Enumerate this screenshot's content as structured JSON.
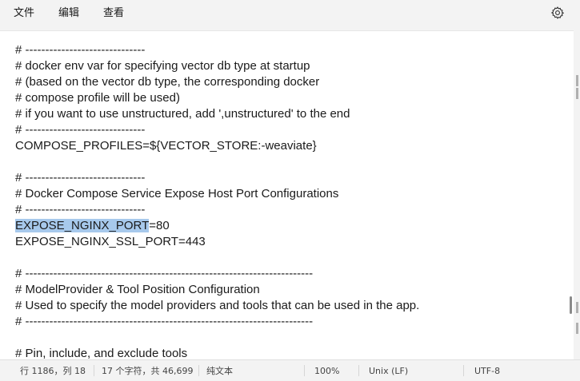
{
  "menu": {
    "file": "文件",
    "edit": "编辑",
    "view": "查看"
  },
  "settings_icon": "gear-icon",
  "editor": {
    "lines": [
      "# ------------------------------",
      "# docker env var for specifying vector db type at startup",
      "# (based on the vector db type, the corresponding docker",
      "# compose profile will be used)",
      "# if you want to use unstructured, add ',unstructured' to the end",
      "# ------------------------------",
      "COMPOSE_PROFILES=${VECTOR_STORE:-weaviate}",
      "",
      "# ------------------------------",
      "# Docker Compose Service Expose Host Port Configurations",
      "# ------------------------------",
      "=80",
      "EXPOSE_NGINX_SSL_PORT=443",
      "",
      "# ------------------------------------------------------------------------",
      "# ModelProvider & Tool Position Configuration",
      "# Used to specify the model providers and tools that can be used in the app.",
      "# ------------------------------------------------------------------------",
      "",
      "# Pin, include, and exclude tools"
    ],
    "selected_text": "EXPOSE_NGINX_PORT"
  },
  "status": {
    "position": "行 1186，列 18",
    "selection": "17 个字符，共 46,699",
    "format": "纯文本",
    "zoom": "100%",
    "line_ending": "Unix (LF)",
    "encoding": "UTF-8"
  }
}
